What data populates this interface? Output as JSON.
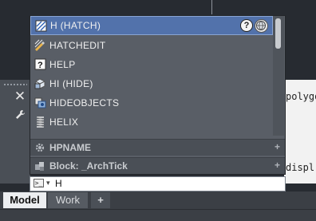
{
  "autocomplete": {
    "items": [
      {
        "label": "H (HATCH)",
        "icon": "hatch-icon"
      },
      {
        "label": "HATCHEDIT",
        "icon": "hatchedit-icon"
      },
      {
        "label": "HELP",
        "icon": "help-icon"
      },
      {
        "label": "HI (HIDE)",
        "icon": "hide-icon"
      },
      {
        "label": "HIDEOBJECTS",
        "icon": "hideobjects-icon"
      },
      {
        "label": "HELIX",
        "icon": "helix-icon"
      }
    ],
    "help_symbol": "?",
    "sections": [
      {
        "label": "HPNAME",
        "icon": "gear-icon",
        "expand": "+"
      },
      {
        "label": "Block: _ArchTick",
        "icon": "block-icon",
        "expand": "+"
      }
    ]
  },
  "command_line": {
    "value": "H",
    "prompt_icon": ">_"
  },
  "history": {
    "lines": [
      "polygon",
      "displ"
    ]
  },
  "layout_tabs": {
    "model": "Model",
    "work": "Work",
    "add": "+"
  },
  "palette": {
    "close_symbol": "✕"
  },
  "colors": {
    "selection": "#5272ab",
    "popup_bg": "#595e66",
    "canvas": "#272b31"
  }
}
